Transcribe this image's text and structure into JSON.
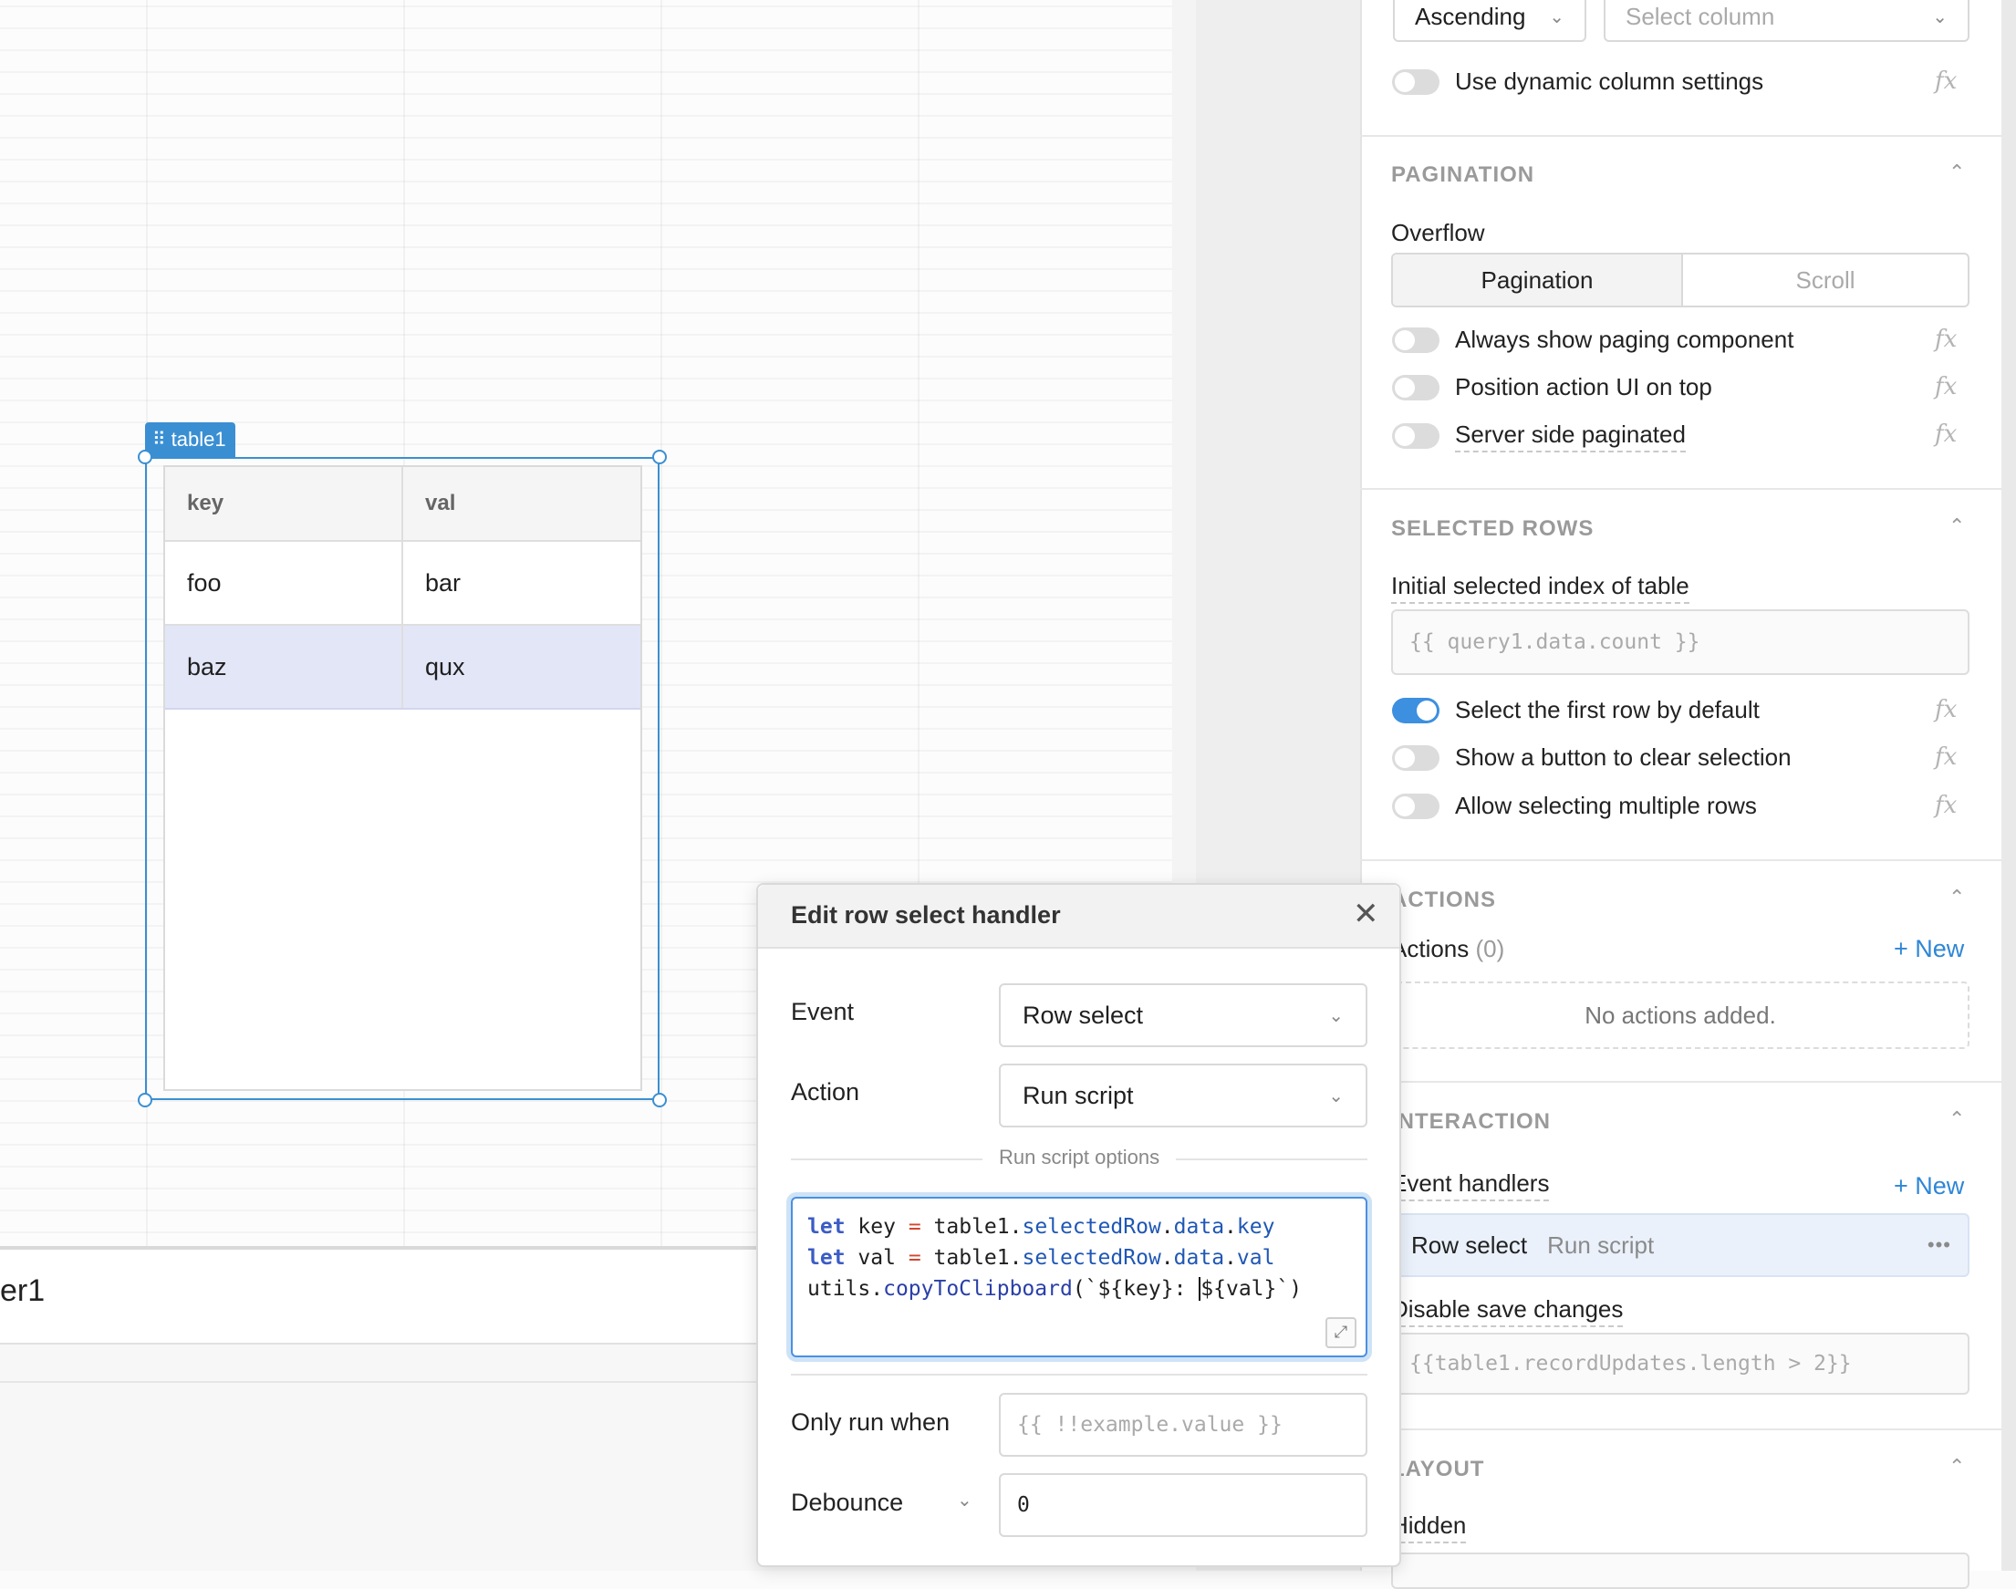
{
  "canvas": {
    "table": {
      "tag": "table1",
      "columns": [
        "key",
        "val"
      ],
      "rows": [
        [
          "foo",
          "bar"
        ],
        [
          "baz",
          "qux"
        ]
      ],
      "selected_row": 1
    },
    "bottom_title": "er1"
  },
  "inspector": {
    "sort": {
      "direction": "Ascending",
      "column_placeholder": "Select column"
    },
    "dynamic_columns": {
      "label": "Use dynamic column settings",
      "on": false
    },
    "pagination": {
      "title": "PAGINATION",
      "overflow_label": "Overflow",
      "segments": [
        "Pagination",
        "Scroll"
      ],
      "active_segment": "Pagination",
      "toggles": [
        {
          "label": "Always show paging component",
          "on": false
        },
        {
          "label": "Position action UI on top",
          "on": false
        },
        {
          "label": "Server side paginated",
          "on": false
        }
      ]
    },
    "selected_rows": {
      "title": "SELECTED ROWS",
      "initial_index_label": "Initial selected index of table",
      "initial_index_placeholder": "{{ query1.data.count }}",
      "toggles": [
        {
          "label": "Select the first row by default",
          "on": true
        },
        {
          "label": "Show a button to clear selection",
          "on": false
        },
        {
          "label": "Allow selecting multiple rows",
          "on": false
        }
      ]
    },
    "actions": {
      "title": "ACTIONS",
      "label": "Actions",
      "count": "(0)",
      "new_label": "+ New",
      "empty": "No actions added."
    },
    "interaction": {
      "title": "INTERACTION",
      "handlers_label": "Event handlers",
      "new_label": "+ New",
      "handler": {
        "event": "Row select",
        "action": "Run script",
        "menu": "•••"
      },
      "disable_save_label": "Disable save changes",
      "disable_save_placeholder": "{{table1.recordUpdates.length > 2}}"
    },
    "layout": {
      "title": "LAYOUT",
      "hidden_label": "Hidden"
    },
    "fx": "fx"
  },
  "modal": {
    "title": "Edit row select handler",
    "event_label": "Event",
    "event_value": "Row select",
    "action_label": "Action",
    "action_value": "Run script",
    "options_label": "Run script options",
    "only_run_label": "Only run when",
    "only_run_placeholder": "{{ !!example.value }}",
    "debounce_label": "Debounce",
    "debounce_value": "0"
  },
  "icons": [
    "drag-handle-icon",
    "chevron-down-icon",
    "chevron-up-icon",
    "close-icon",
    "expand-icon",
    "more-icon"
  ]
}
